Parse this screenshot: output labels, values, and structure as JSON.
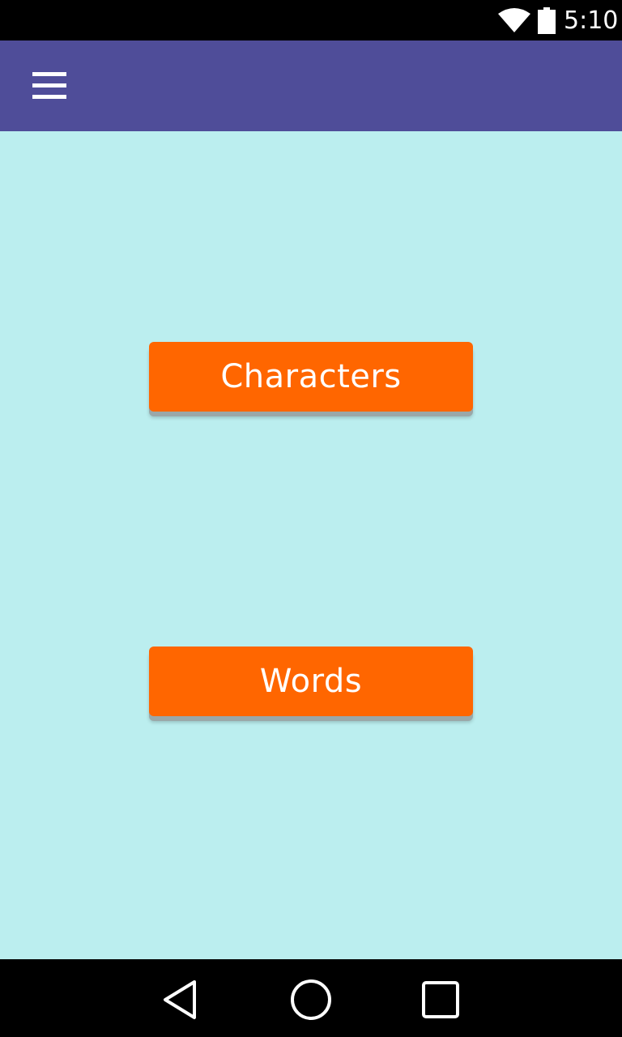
{
  "status_bar": {
    "time": "5:10",
    "icons": [
      "wifi-icon",
      "battery-icon"
    ]
  },
  "app_bar": {
    "menu_icon": "hamburger-menu-icon"
  },
  "main": {
    "buttons": [
      {
        "label": "Characters"
      },
      {
        "label": "Words"
      }
    ]
  },
  "nav_bar": {
    "icons": [
      "back-icon",
      "home-icon",
      "recents-icon"
    ]
  },
  "colors": {
    "app_bar": "#4f4d99",
    "background": "#bbeeef",
    "button": "#ff6600",
    "button_text": "#ffffff"
  }
}
